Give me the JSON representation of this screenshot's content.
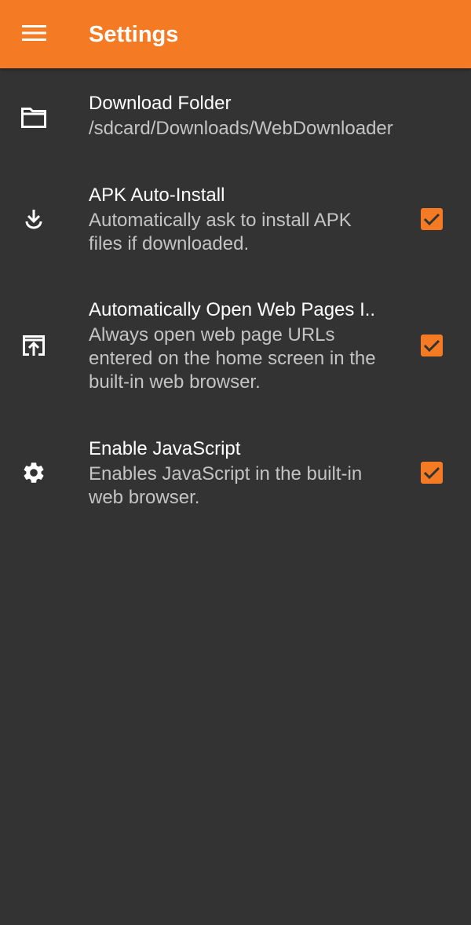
{
  "app_bar": {
    "title": "Settings",
    "menu_icon": "hamburger-menu-icon",
    "background": "#F47A24"
  },
  "settings": [
    {
      "icon": "folder-icon",
      "title": "Download Folder",
      "summary": "/sdcard/Downloads/WebDownloader"
    },
    {
      "icon": "download-icon",
      "title": "APK Auto-Install",
      "summary": "Automatically ask to install APK files if downloaded.",
      "checked": true
    },
    {
      "icon": "open-in-browser-icon",
      "title": "Automatically Open Web Pages I..",
      "summary": "Always open web page URLs entered on the home screen in the built-in web browser.",
      "checked": true
    },
    {
      "icon": "gear-icon",
      "title": "Enable JavaScript",
      "summary": "Enables JavaScript in the built-in web browser.",
      "checked": true
    }
  ],
  "colors": {
    "accent": "#F47A24",
    "background": "#333333",
    "primary_text": "#FFFFFF",
    "secondary_text": "#C4C4C4"
  }
}
